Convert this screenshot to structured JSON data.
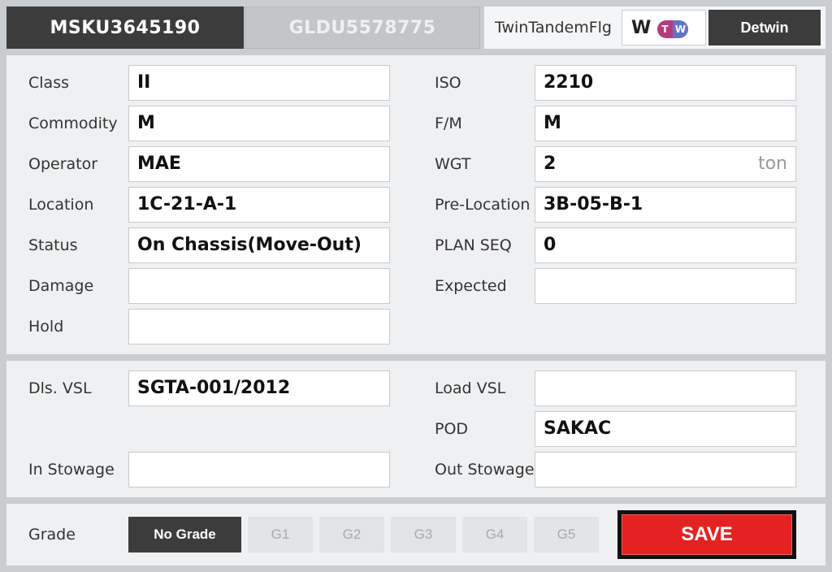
{
  "tabs": [
    {
      "label": "MSKU3645190",
      "active": true
    },
    {
      "label": "GLDU5578775",
      "active": false
    }
  ],
  "twin": {
    "label": "TwinTandemFlg",
    "value": "W",
    "badge_t": "T",
    "badge_w": "W",
    "detwin_label": "Detwin",
    "badge_colors": {
      "t": "#b83a7d",
      "w": "#5f74c6"
    }
  },
  "container_info": {
    "class_label": "Class",
    "class_value": "II",
    "iso_label": "ISO",
    "iso_value": "2210",
    "commodity_label": "Commodity",
    "commodity_value": "M",
    "fm_label": "F/M",
    "fm_value": "M",
    "operator_label": "Operator",
    "operator_value": "MAE",
    "wgt_label": "WGT",
    "wgt_value": "2",
    "wgt_unit": "ton",
    "location_label": "Location",
    "location_value": "1C-21-A-1",
    "prelocation_label": "Pre-Location",
    "prelocation_value": "3B-05-B-1",
    "status_label": "Status",
    "status_value": "On Chassis(Move-Out)",
    "planseq_label": "PLAN SEQ",
    "planseq_value": "0",
    "damage_label": "Damage",
    "damage_value": "",
    "expected_label": "Expected",
    "expected_value": "",
    "hold_label": "Hold",
    "hold_value": ""
  },
  "vessel_info": {
    "dls_vsl_label": "Dls. VSL",
    "dls_vsl_value": "SGTA-001/2012",
    "load_vsl_label": "Load VSL",
    "load_vsl_value": "",
    "pod_label": "POD",
    "pod_value": "SAKAC",
    "in_stowage_label": "In Stowage",
    "in_stowage_value": "",
    "out_stowage_label": "Out Stowage",
    "out_stowage_value": ""
  },
  "grade": {
    "label": "Grade",
    "options": [
      "No Grade",
      "G1",
      "G2",
      "G3",
      "G4",
      "G5"
    ],
    "selected": "No Grade"
  },
  "save_label": "SAVE",
  "colors": {
    "accent": "#e52222",
    "dark": "#3c3c3c"
  }
}
